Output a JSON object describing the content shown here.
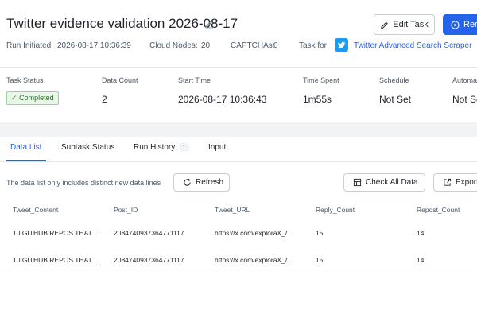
{
  "task": {
    "title": "Twitter evidence validation 2026-08-17",
    "edit_label": "Edit Task",
    "run_label": "Rerun"
  },
  "meta": {
    "run_initiated_label": "Run Initiated:",
    "run_initiated_value": "2026-08-17 10:36:39",
    "cloud_nodes_label": "Cloud Nodes:",
    "cloud_nodes_value": "20",
    "captchas_label": "CAPTCHAs:",
    "captchas_value": "0",
    "task_for_label": "Task for",
    "scraper_name": "Twitter Advanced Search Scraper"
  },
  "stats": {
    "task_status": {
      "label": "Task Status",
      "value": "Completed"
    },
    "data_count": {
      "label": "Data Count",
      "value": "2"
    },
    "start_time": {
      "label": "Start Time",
      "value": "2026-08-17 10:36:43"
    },
    "time_spent": {
      "label": "Time Spent",
      "value": "1m55s"
    },
    "schedule": {
      "label": "Schedule",
      "value": "Not Set"
    },
    "automation": {
      "label": "Automati",
      "value": "Not Se"
    }
  },
  "tabs": [
    {
      "label": "Data List",
      "count": ""
    },
    {
      "label": "Subtask Status",
      "count": ""
    },
    {
      "label": "Run History",
      "count": "1"
    },
    {
      "label": "Input",
      "count": ""
    }
  ],
  "toolbar": {
    "hint": "The data list only includes distinct new data lines",
    "refresh_label": "Refresh",
    "check_all_label": "Check All Data",
    "export_label": "Export"
  },
  "table": {
    "columns": [
      "Tweet_Content",
      "Post_ID",
      "Tweet_URL",
      "Reply_Count",
      "Repost_Count"
    ],
    "rows": [
      [
        "10 GITHUB REPOS THAT ...",
        "2084740937364771117",
        "https://x.com/exploraX_/...",
        "15",
        "14"
      ],
      [
        "10 GITHUB REPOS THAT ...",
        "2084740937364771117",
        "https://x.com/exploraX_/...",
        "15",
        "14"
      ]
    ]
  },
  "colors": {
    "accent": "#2563eb",
    "twitter": "#1d9bf0",
    "success": "#1f7a1f"
  }
}
